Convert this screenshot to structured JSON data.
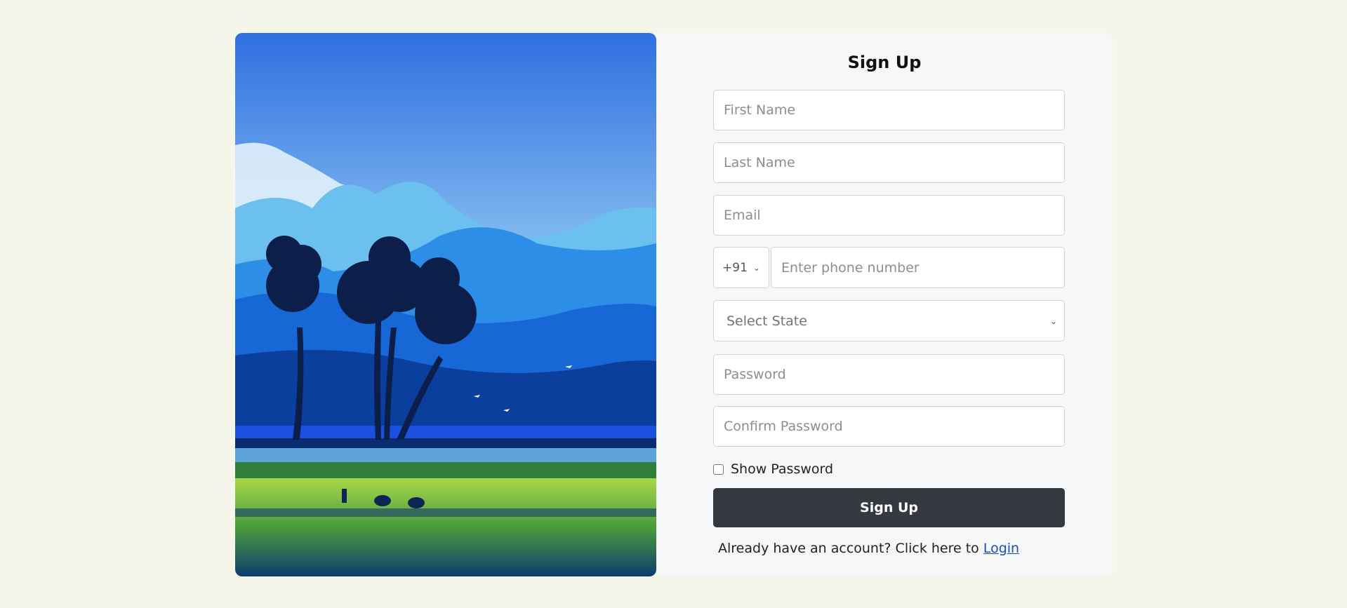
{
  "form": {
    "title": "Sign Up",
    "first_name_placeholder": "First Name",
    "last_name_placeholder": "Last Name",
    "email_placeholder": "Email",
    "country_code": "+91",
    "phone_placeholder": "Enter phone number",
    "state_placeholder": "Select State",
    "password_placeholder": "Password",
    "confirm_password_placeholder": "Confirm Password",
    "show_password_label": "Show Password",
    "submit_label": "Sign Up",
    "login_prompt": "Already have an account? Click here to",
    "login_link": "Login"
  },
  "icons": {
    "country_chevron": "chevron-down-icon",
    "state_chevron": "chevron-down-icon"
  },
  "colors": {
    "page_background": "#f5f6e9",
    "panel_background": "#f6f7f9",
    "button": "#35393f",
    "link": "#1a4fc4"
  }
}
